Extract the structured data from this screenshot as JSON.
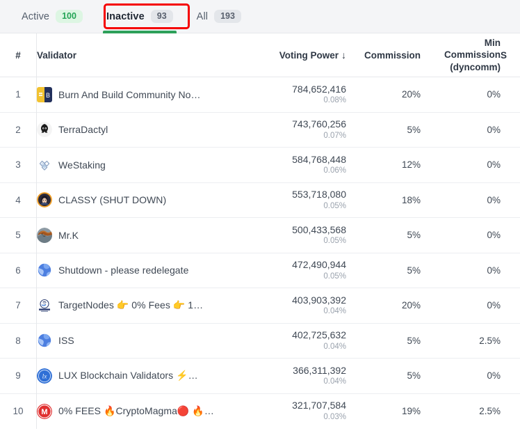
{
  "tabs": [
    {
      "label": "Active",
      "count": "100",
      "badge_style": "green",
      "selected": false
    },
    {
      "label": "Inactive",
      "count": "93",
      "badge_style": "grey",
      "selected": true
    },
    {
      "label": "All",
      "count": "193",
      "badge_style": "grey",
      "selected": false
    }
  ],
  "annotation": {
    "color": "#f50000",
    "target": "Inactive tab"
  },
  "table": {
    "headers": {
      "rank": "#",
      "validator": "Validator",
      "voting_power": "Voting Power",
      "sort_arrow": "↓",
      "commission": "Commission",
      "min_commission": "Min Commission (dyncomm)",
      "min_commission_line1": "Min",
      "min_commission_line2": "Commission",
      "min_commission_line3": "(dyncomm)",
      "extra_cut_off": "S"
    },
    "rows": [
      {
        "rank": "1",
        "name": "Burn And Build Community No…",
        "avatar": "burn-build",
        "voting_power": "784,652,416",
        "share": "0.08%",
        "commission": "20%",
        "min_commission": "0%"
      },
      {
        "rank": "2",
        "name": "TerraDactyl",
        "avatar": "terradactyl",
        "voting_power": "743,760,256",
        "share": "0.07%",
        "commission": "5%",
        "min_commission": "0%"
      },
      {
        "rank": "3",
        "name": "WeStaking",
        "avatar": "westaking",
        "voting_power": "584,768,448",
        "share": "0.06%",
        "commission": "12%",
        "min_commission": "0%"
      },
      {
        "rank": "4",
        "name": "CLASSY (SHUT DOWN)",
        "avatar": "classy",
        "voting_power": "553,718,080",
        "share": "0.05%",
        "commission": "18%",
        "min_commission": "0%"
      },
      {
        "rank": "5",
        "name": "Mr.K",
        "avatar": "mrk",
        "voting_power": "500,433,568",
        "share": "0.05%",
        "commission": "5%",
        "min_commission": "0%"
      },
      {
        "rank": "6",
        "name": "Shutdown - please redelegate",
        "avatar": "globe",
        "voting_power": "472,490,944",
        "share": "0.05%",
        "commission": "5%",
        "min_commission": "0%"
      },
      {
        "rank": "7",
        "name": "TargetNodes 👉 0% Fees 👉 1…",
        "avatar": "target",
        "voting_power": "403,903,392",
        "share": "0.04%",
        "commission": "20%",
        "min_commission": "0%"
      },
      {
        "rank": "8",
        "name": "ISS",
        "avatar": "globe",
        "voting_power": "402,725,632",
        "share": "0.04%",
        "commission": "5%",
        "min_commission": "2.5%"
      },
      {
        "rank": "9",
        "name": "LUX Blockchain Validators ⚡…",
        "avatar": "lux",
        "voting_power": "366,311,392",
        "share": "0.04%",
        "commission": "5%",
        "min_commission": "0%"
      },
      {
        "rank": "10",
        "name": "0% FEES 🔥CryptoMagma🔴 🔥…",
        "avatar": "magma",
        "voting_power": "321,707,584",
        "share": "0.03%",
        "commission": "19%",
        "min_commission": "2.5%"
      }
    ]
  },
  "colors": {
    "accent_green": "#2ea05a",
    "badge_green_bg": "#ddf6e3",
    "badge_green_text": "#23a455",
    "badge_grey_bg": "#e3e6ea",
    "annotation_red": "#f50000",
    "tabbar_bg": "#f4f5f7"
  }
}
